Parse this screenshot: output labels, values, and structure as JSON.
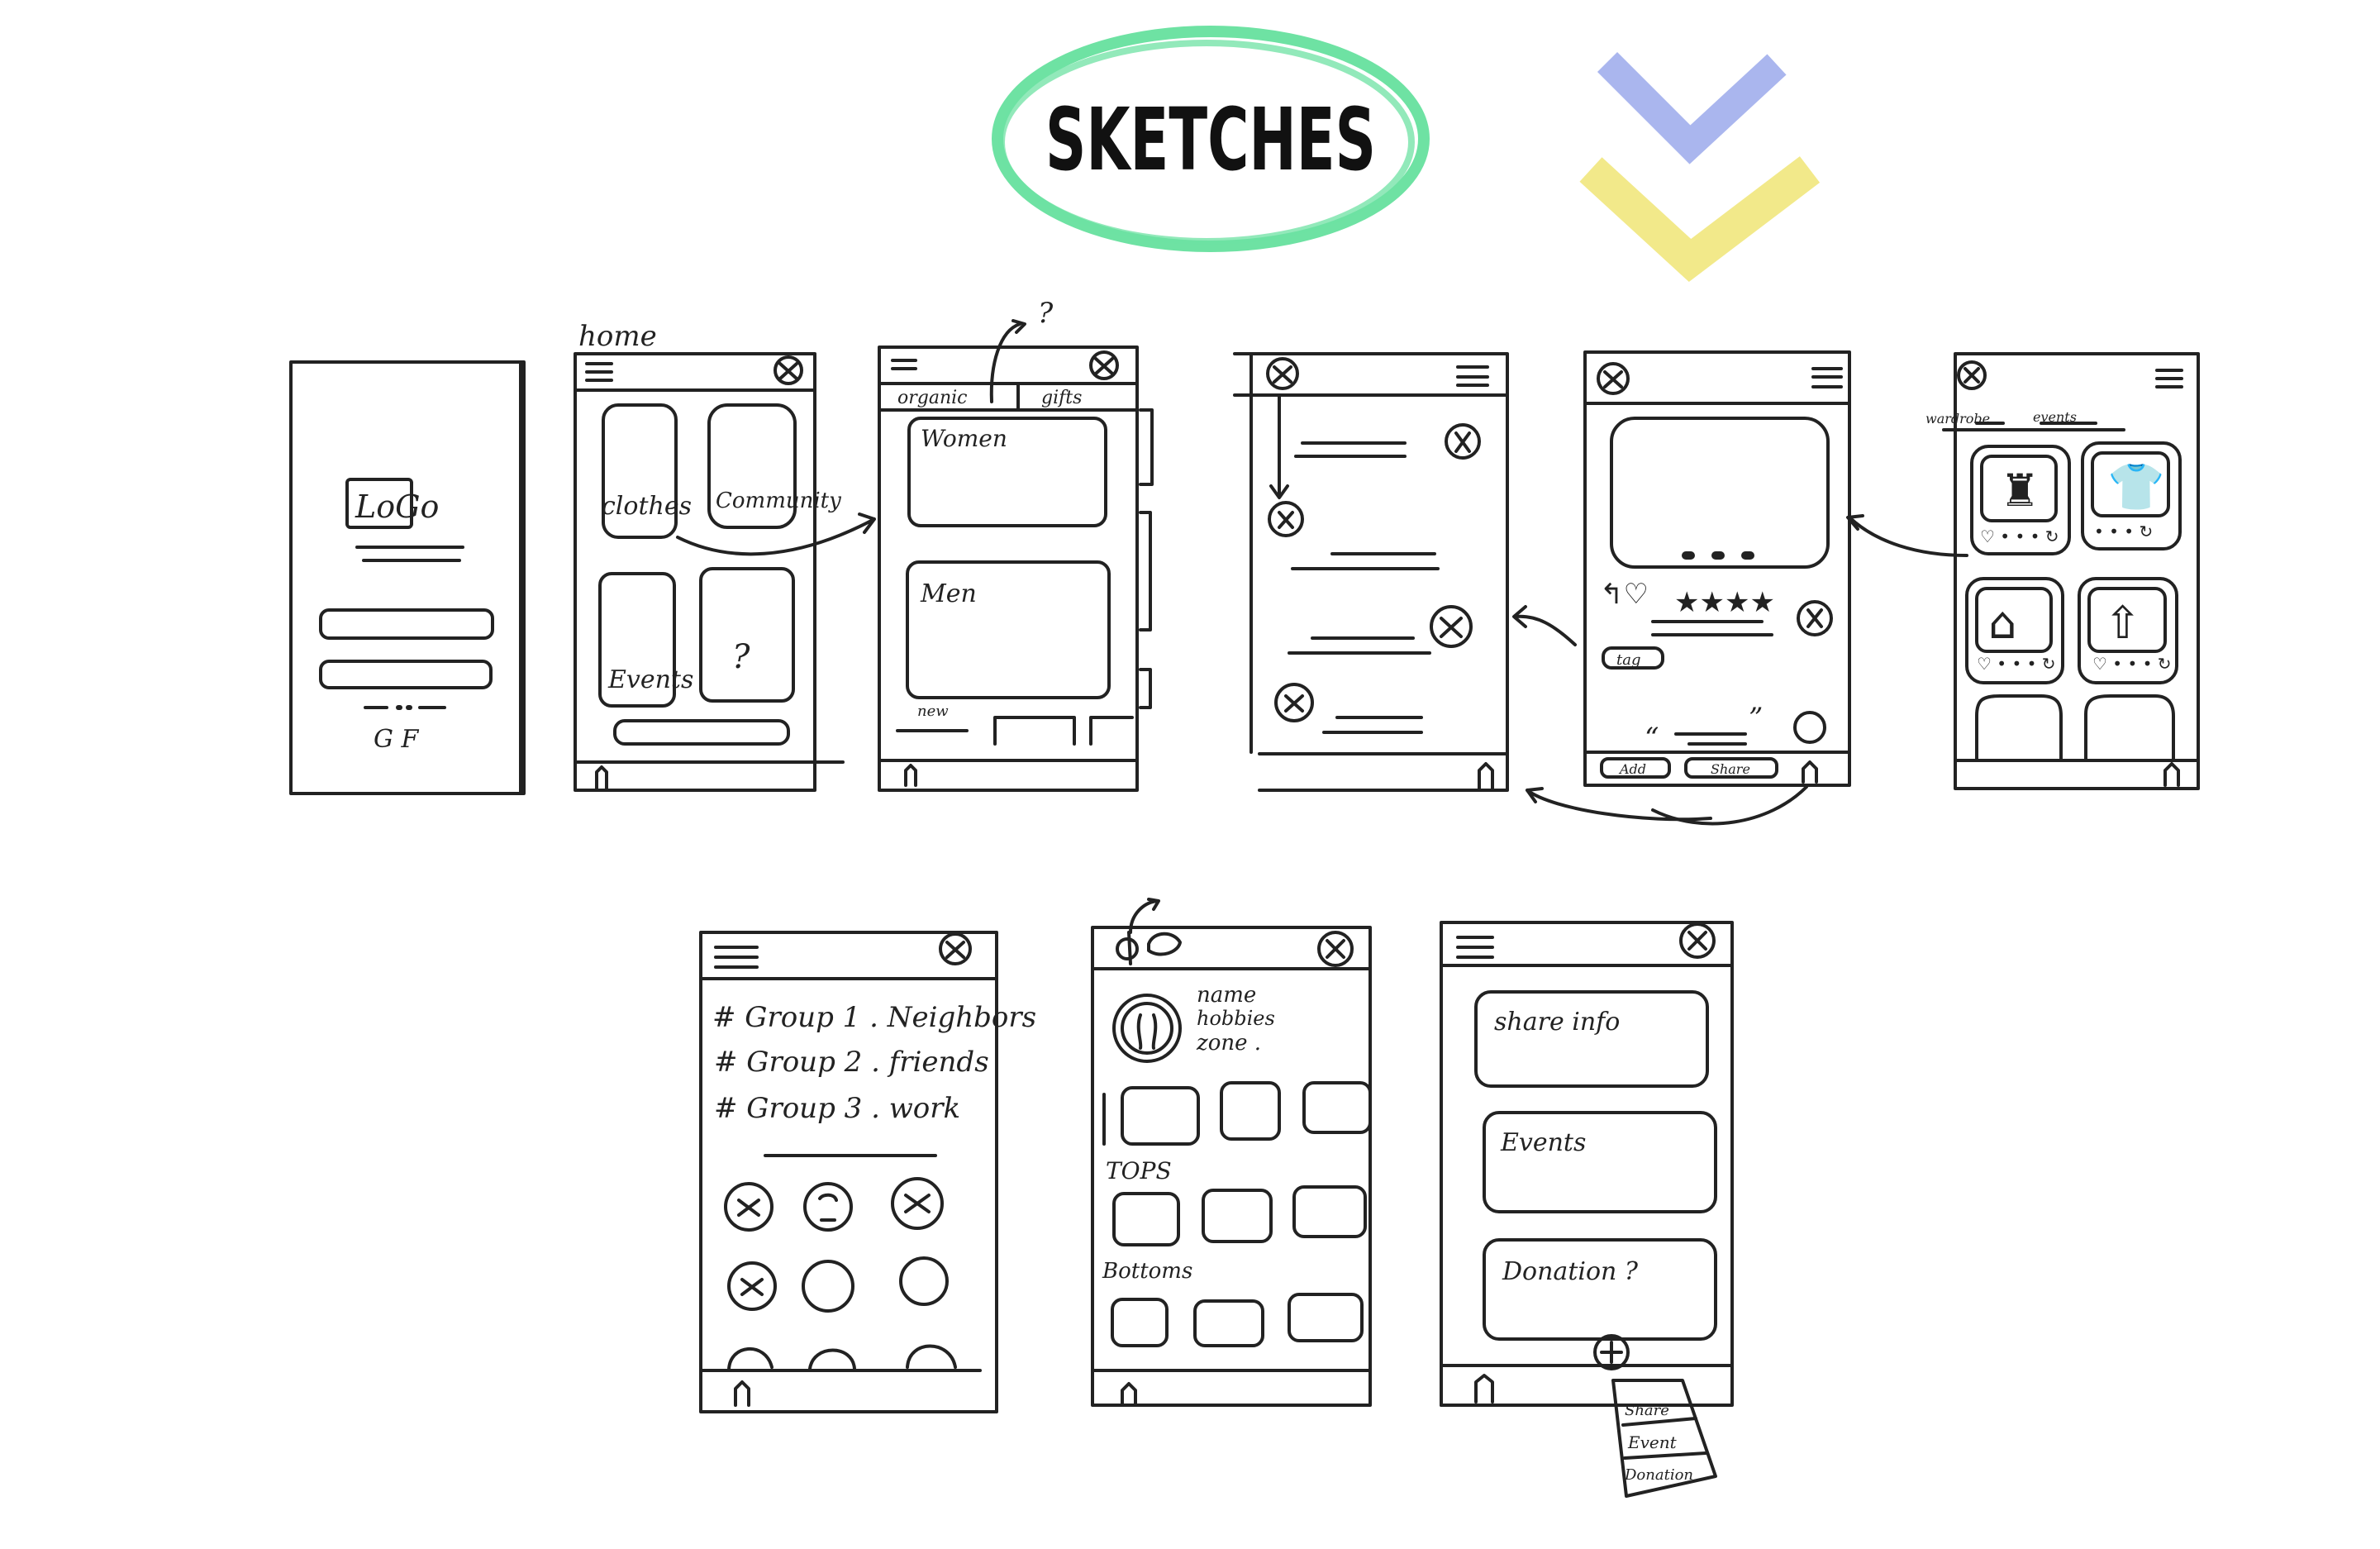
{
  "header": {
    "title": "SKETCHES",
    "title_ring_color": "#6ee2a3",
    "chevron_top_color": "#aab6ee",
    "chevron_bottom_color": "#f2e98a"
  },
  "screens": {
    "login": {
      "logo": "LoGo",
      "footer": "G F"
    },
    "home": {
      "page_label": "home",
      "tiles": [
        "clothes",
        "Community",
        "Events",
        "?"
      ]
    },
    "clothes": {
      "tabs": [
        "organic",
        "gifts"
      ],
      "question": "?",
      "cards": [
        "Women",
        "Men"
      ],
      "footer_label": "new"
    },
    "chat": {},
    "product": {
      "tag": "tag",
      "quote_open": "“",
      "quote_close": "”",
      "buttons": [
        "Add",
        "Share"
      ]
    },
    "wardrobe": {
      "tabs": [
        "wardrobe",
        "events"
      ]
    },
    "groups": {
      "items": [
        "# Group 1 . Neighbors",
        "# Group 2 . friends",
        "# Group 3 . work"
      ]
    },
    "profile": {
      "info": [
        "name",
        "hobbies",
        "zone ."
      ],
      "sections": [
        "TOPS",
        "Bottoms"
      ]
    },
    "share": {
      "cards": [
        "share info",
        "Events",
        "Donation ?"
      ],
      "menu": [
        "Share",
        "Event",
        "Donation"
      ]
    }
  }
}
